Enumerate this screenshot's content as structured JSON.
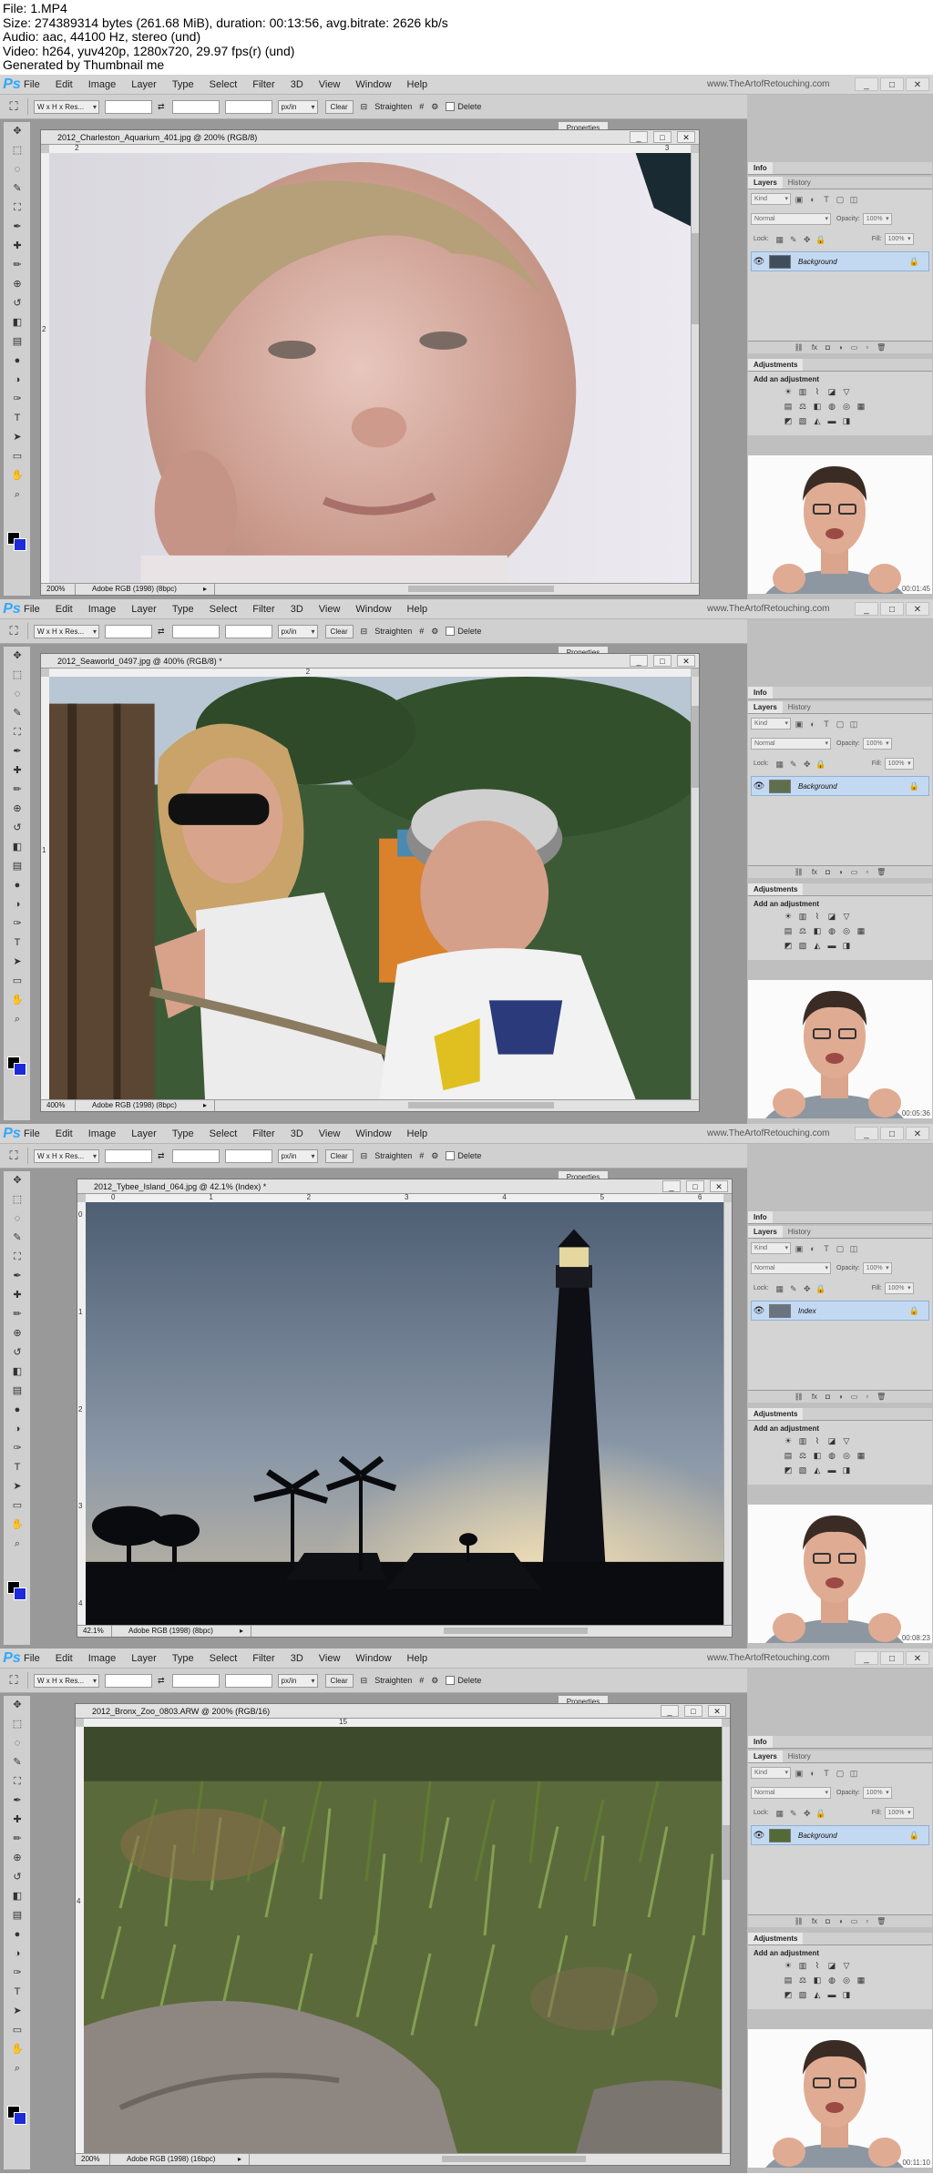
{
  "header": {
    "lines": [
      "File: 1.MP4",
      "Size: 274389314 bytes (261.68 MiB), duration: 00:13:56, avg.bitrate: 2626 kb/s",
      "Audio: aac, 44100 Hz, stereo (und)",
      "Video: h264, yuv420p, 1280x720, 29.97 fps(r) (und)",
      "Generated by Thumbnail me"
    ]
  },
  "app": {
    "logo": "Ps",
    "menu": [
      "File",
      "Edit",
      "Image",
      "Layer",
      "Type",
      "Select",
      "Filter",
      "3D",
      "View",
      "Window",
      "Help"
    ],
    "watermark": "www.TheArtofRetouching.com",
    "window_buttons": [
      "_",
      "□",
      "✕"
    ]
  },
  "options": {
    "ratio": "W x H x Res...",
    "units": "px/in",
    "clear": "Clear",
    "straighten": "Straighten",
    "delete": "Delete",
    "properties_tab": "Properties"
  },
  "panels": {
    "info_tab": "Info",
    "layers_tab": "Layers",
    "history_tab": "History",
    "kind": "Kind",
    "blend": "Normal",
    "opacity_label": "Opacity:",
    "opacity": "100%",
    "lock_label": "Lock:",
    "fill_label": "Fill:",
    "fill": "100%",
    "adjustments_tab": "Adjustments",
    "add_adjustment": "Add an adjustment"
  },
  "frames": [
    {
      "doc_title": "2012_Charleston_Aquarium_401.jpg @ 200% (RGB/8)",
      "zoom": "200%",
      "profile": "Adobe RGB (1998) (8bpc)",
      "layer_name": "Background",
      "ruler_marks": [
        "2",
        "3"
      ],
      "vruler_marks": [
        "2"
      ],
      "timestamp": "00:01:45"
    },
    {
      "doc_title": "2012_Seaworld_0497.jpg @ 400% (RGB/8) *",
      "zoom": "400%",
      "profile": "Adobe RGB (1998) (8bpc)",
      "layer_name": "Background",
      "ruler_marks": [
        "2"
      ],
      "vruler_marks": [
        "1"
      ],
      "timestamp": "00:05:36"
    },
    {
      "doc_title": "2012_Tybee_Island_064.jpg @ 42.1% (Index) *",
      "zoom": "42.1%",
      "profile": "Adobe RGB (1998) (8bpc)",
      "layer_name": "Index",
      "ruler_marks": [
        "0",
        "1",
        "2",
        "3",
        "4",
        "5",
        "6"
      ],
      "vruler_marks": [
        "0",
        "1",
        "2",
        "3",
        "4"
      ],
      "timestamp": "00:08:23"
    },
    {
      "doc_title": "2012_Bronx_Zoo_0803.ARW @ 200% (RGB/16)",
      "zoom": "200%",
      "profile": "Adobe RGB (1998) (16bpc)",
      "layer_name": "Background",
      "ruler_marks": [
        "15"
      ],
      "vruler_marks": [
        "4"
      ],
      "timestamp": "00:11:10"
    }
  ],
  "icons": {
    "tools": [
      "move-icon",
      "marquee-icon",
      "lasso-icon",
      "quick-select-icon",
      "crop-icon",
      "eyedropper-icon",
      "healing-icon",
      "brush-icon",
      "stamp-icon",
      "history-brush-icon",
      "eraser-icon",
      "gradient-icon",
      "blur-icon",
      "dodge-icon",
      "pen-icon",
      "type-icon",
      "path-select-icon",
      "shape-icon",
      "hand-icon",
      "zoom-icon"
    ]
  }
}
